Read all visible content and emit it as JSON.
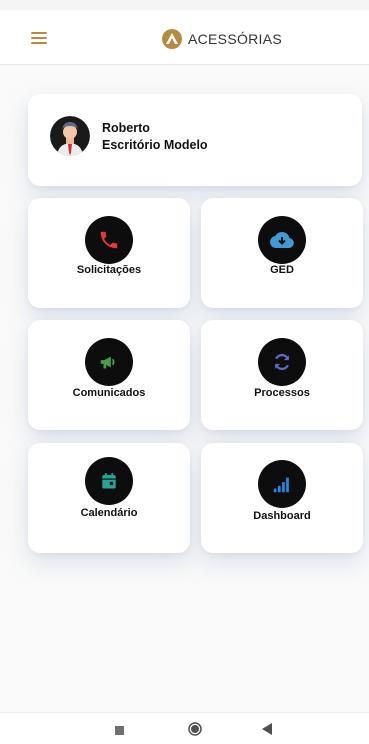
{
  "header": {
    "title": "ACESSÓRIAS",
    "logo_icon": "a-logo-icon",
    "menu_icon": "hamburger-menu-icon",
    "accent": "#b88a3e"
  },
  "profile": {
    "name": "Roberto",
    "office": "Escritório Modelo",
    "avatar_icon": "user-avatar-icon"
  },
  "tiles": [
    {
      "label": "Solicitações",
      "icon": "phone-icon",
      "color": "#e53935"
    },
    {
      "label": "GED",
      "icon": "cloud-download-icon",
      "color": "#3f9bd6"
    },
    {
      "label": "Comunicados",
      "icon": "megaphone-icon",
      "color": "#43a047"
    },
    {
      "label": "Processos",
      "icon": "refresh-icon",
      "color": "#5c6bc0"
    },
    {
      "label": "Calendário",
      "icon": "calendar-icon",
      "color": "#26a69a"
    },
    {
      "label": "Dashboard",
      "icon": "signal-bars-icon",
      "color": "#1e88e5"
    }
  ],
  "system_nav": {
    "recent_icon": "square-stop-icon",
    "home_icon": "circle-home-icon",
    "back_icon": "triangle-back-icon"
  }
}
